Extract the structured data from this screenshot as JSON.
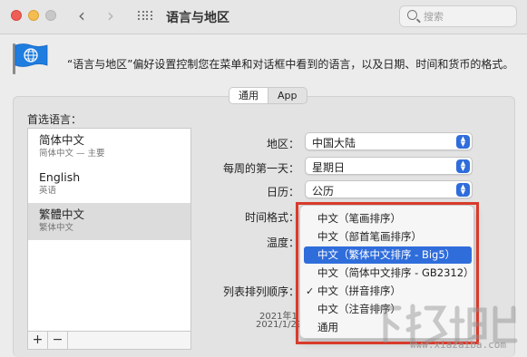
{
  "window": {
    "title": "语言与地区"
  },
  "search": {
    "placeholder": "搜索"
  },
  "description": "“语言与地区”偏好设置控制您在菜单和对话框中看到的语言，以及日期、时间和货币的格式。",
  "tabs": [
    {
      "label": "通用",
      "active": true
    },
    {
      "label": "App",
      "active": false
    }
  ],
  "preferred": {
    "label": "首选语言：",
    "languages": [
      {
        "name": "简体中文",
        "sub": "简体中文 — 主要"
      },
      {
        "name": "English",
        "sub": "英语"
      },
      {
        "name": "繁體中文",
        "sub": "繁体中文",
        "selected": true
      }
    ],
    "add": "+",
    "remove": "−"
  },
  "settings": {
    "region_label": "地区：",
    "region_value": "中国大陆",
    "first_day_label": "每周的第一天：",
    "first_day_value": "星期日",
    "calendar_label": "日历：",
    "calendar_value": "公历",
    "time_format_label": "时间格式：",
    "temperature_label": "温度：",
    "sort_order_label": "列表排列顺序："
  },
  "date_preview": {
    "line1": "2021年1",
    "line2": "2021/1/29"
  },
  "sort_menu": {
    "items": [
      {
        "label": "中文（笔画排序）"
      },
      {
        "label": "中文（部首笔画排序）"
      },
      {
        "label": "中文（繁体中文排序 - Big5）",
        "highlighted": true
      },
      {
        "label": "中文（简体中文排序 - GB2312）"
      },
      {
        "label": "中文（拼音排序）",
        "checked": true
      },
      {
        "label": "中文（注音排序）"
      },
      {
        "label": "通用"
      }
    ]
  },
  "watermark": {
    "text": "www.xiazaiba.com"
  },
  "colors": {
    "accent": "#2f6ddb",
    "highlight_border": "#d93a2b",
    "flag": "#1f7de0"
  }
}
